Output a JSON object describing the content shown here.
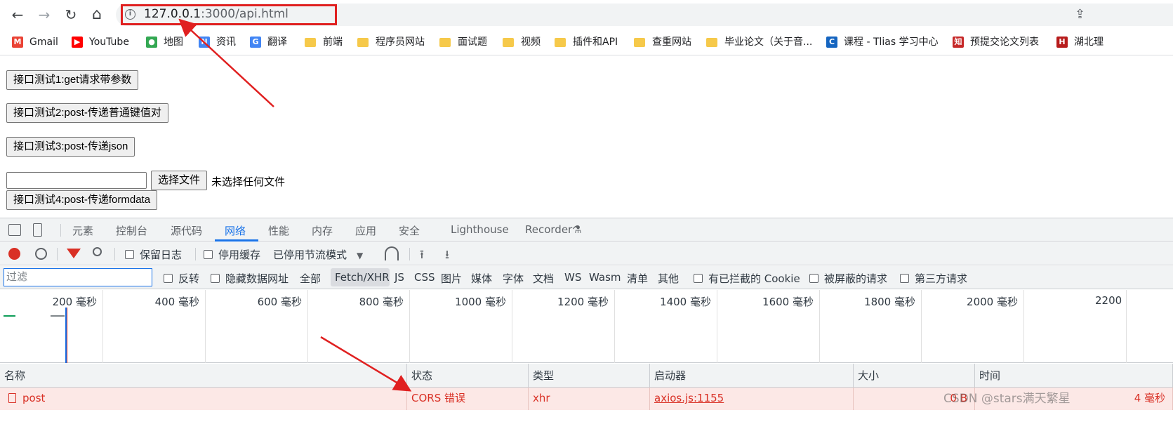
{
  "browser": {
    "nav": {
      "back": "←",
      "forward": "→",
      "reload": "↻",
      "home": "⌂"
    },
    "url": {
      "host": "127.0.0.1",
      "rest": ":3000/api.html"
    },
    "info_icon": "i",
    "share_icon": "⇪"
  },
  "bookmarks": [
    {
      "label": "Gmail",
      "icon": "gmail-icon",
      "glyph": "M",
      "color": "#ea4335"
    },
    {
      "label": "YouTube",
      "icon": "youtube-icon",
      "glyph": "▶",
      "color": "#ff0000"
    },
    {
      "label": "地图",
      "icon": "maps-icon",
      "glyph": "●",
      "color": "#34a853"
    },
    {
      "label": "资讯",
      "icon": "news-icon",
      "glyph": "N",
      "color": "#4285f4"
    },
    {
      "label": "翻译",
      "icon": "translate-icon",
      "glyph": "G",
      "color": "#4285f4"
    },
    {
      "label": "前端",
      "icon": "folder-icon"
    },
    {
      "label": "程序员网站",
      "icon": "folder-icon"
    },
    {
      "label": "面试题",
      "icon": "folder-icon"
    },
    {
      "label": "视频",
      "icon": "folder-icon"
    },
    {
      "label": "插件和API",
      "icon": "folder-icon"
    },
    {
      "label": "查重网站",
      "icon": "folder-icon"
    },
    {
      "label": "毕业论文（关于音...",
      "icon": "folder-icon"
    },
    {
      "label": "课程 - Tlias 学习中心",
      "icon": "course-icon",
      "glyph": "C",
      "color": "#1565c0"
    },
    {
      "label": "预提交论文列表",
      "icon": "zhi-icon",
      "glyph": "知",
      "color": "#c62828"
    },
    {
      "label": "湖北理",
      "icon": "hubei-icon",
      "glyph": "H",
      "color": "#b71c1c"
    }
  ],
  "page": {
    "btn1": "接口测试1:get请求带参数",
    "btn2": "接口测试2:post-传递普通键值对",
    "btn3": "接口测试3:post-传递json",
    "choose_file": "选择文件",
    "no_file": "未选择任何文件",
    "btn4": "接口测试4:post-传递formdata"
  },
  "devtools": {
    "tabs": [
      "元素",
      "控制台",
      "源代码",
      "网络",
      "性能",
      "内存",
      "应用",
      "安全",
      "Lighthouse",
      "Recorder"
    ],
    "active_tab": "网络",
    "recorder_icon": "⚗",
    "controls": {
      "preserve_log": "保留日志",
      "disable_cache": "停用缓存",
      "throttle": "已停用节流模式",
      "dropdown": "▼"
    },
    "filter": {
      "placeholder": "过滤",
      "invert": "反转",
      "hide_data_urls": "隐藏数据网址",
      "types": [
        "全部",
        "Fetch/XHR",
        "JS",
        "CSS",
        "图片",
        "媒体",
        "字体",
        "文档",
        "WS",
        "Wasm",
        "清单",
        "其他"
      ],
      "blocked_cookies": "有已拦截的 Cookie",
      "blocked_requests": "被屏蔽的请求",
      "third_party": "第三方请求"
    },
    "timeline_labels": [
      "200 毫秒",
      "400 毫秒",
      "600 毫秒",
      "800 毫秒",
      "1000 毫秒",
      "1200 毫秒",
      "1400 毫秒",
      "1600 毫秒",
      "1800 毫秒",
      "2000 毫秒",
      "2200"
    ],
    "columns": [
      "名称",
      "状态",
      "类型",
      "启动器",
      "大小",
      "时间"
    ],
    "rows": [
      {
        "name": "post",
        "status": "CORS 错误",
        "type": "xhr",
        "initiator": "axios.js:1155",
        "size": "0 B",
        "time": "4 毫秒"
      }
    ]
  },
  "watermark": "CSDN @stars满天繁星",
  "colors": {
    "accent": "#1a73e8",
    "error": "#d93025",
    "annotation": "#e02020"
  }
}
